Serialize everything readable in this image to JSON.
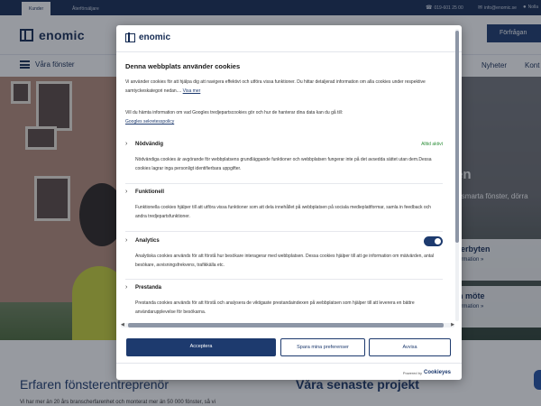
{
  "topbar": {
    "tabs": [
      "Kunder",
      "Återförsäljare"
    ],
    "phone": "019-601 25 00",
    "email": "info@enomic.se",
    "extra": "Nolla"
  },
  "header": {
    "brand": "enomic",
    "cta": "Förfrågan"
  },
  "nav": {
    "menu_label": "Våra fönster",
    "links": [
      "Nyheter",
      "Kont"
    ]
  },
  "hero": {
    "title": "en",
    "subtitle": "ismarta fönster, dörra",
    "cards": [
      {
        "title": "terbyten",
        "sub": "ormation »"
      },
      {
        "title": "n möte",
        "sub": "ormation »"
      }
    ]
  },
  "sections": {
    "left_title": "Erfaren fönsterentreprenör",
    "right_title": "Våra senaste projekt",
    "left_text": "Vi har mer än 20 års branscherfarenhet och monterat mer än 50 000 fönster, så vi"
  },
  "modal": {
    "brand": "enomic",
    "title": "Denna webbplats använder cookies",
    "intro": "Vi använder cookies för att hjälpa dig att navigera effektivt och utföra vissa funktioner. Du hittar detaljerad information om alla cookies under respektive samtyckeskategori nedan....",
    "read_more": "Visa mer",
    "google_text": "Vill du hämta information om vad Googles tredjepartscookies gör och hur de hanterar dina data kan du gå till:",
    "google_link": "Googles sekretesspolicy",
    "categories": [
      {
        "name": "Nödvändig",
        "status": "Alltid aktivt",
        "desc": "Nödvändiga cookies är avgörande för webbplatsens grundläggande funktioner och webbplatsen fungerar inte på det avsedda sättet utan dem.Dessa cookies lagrar inga personligt identifierbara uppgifter."
      },
      {
        "name": "Funktionell",
        "desc": "Funktionella cookies hjälper till att utföra vissa funktioner som att dela innehållet på webbplatsen på sociala medieplattformar, samla in feedback och andra tredjepartsfunktioner."
      },
      {
        "name": "Analytics",
        "toggle_on": true,
        "desc": "Analytiska cookies används för att förstå hur besökare interagerar med webbplatsen. Dessa cookies hjälper till att ge information om mätvärden, antal besökare, avvisningsfrekvens, trafikkälla etc."
      },
      {
        "name": "Prestanda",
        "desc": "Prestanda cookies används för att förstå och analysera de viktigaste prestandaindexen på webbplatsen som hjälper till att leverera en bättre användarupplevelse för besökarna."
      }
    ],
    "buttons": {
      "accept": "Acceptera",
      "save": "Spara mina preferenser",
      "reject": "Avvisa"
    },
    "powered_by": "Powered by",
    "powered_brand": "Cookieyes"
  },
  "colors": {
    "navy": "#1d3a6e",
    "always_active": "#2f8f3b"
  }
}
